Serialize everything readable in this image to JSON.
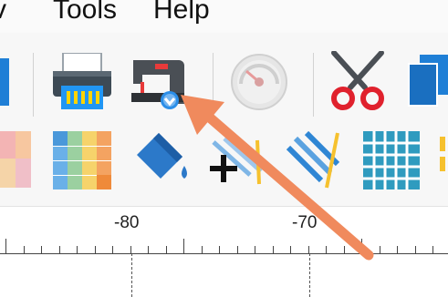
{
  "menubar": {
    "items": [
      {
        "key": "view_fragment",
        "label": "v"
      },
      {
        "key": "tools",
        "label": "Tools"
      },
      {
        "key": "help",
        "label": "Help"
      }
    ]
  },
  "toolbar": {
    "row1": [
      "partial-blue-icon",
      "printer-icon",
      "sewing-machine-icon",
      "speedometer-icon",
      "scissors-icon",
      "copy-icon"
    ],
    "row2": [
      "color-block-partial-icon",
      "color-palette-icon",
      "paint-bucket-icon",
      "add-stitch-icon",
      "stripes-icon",
      "grid-icon",
      "partial-yellow-icon"
    ]
  },
  "ruler": {
    "labels": [
      "-80",
      "-70"
    ]
  },
  "annotation": {
    "type": "arrow",
    "color": "#f08a5d"
  }
}
